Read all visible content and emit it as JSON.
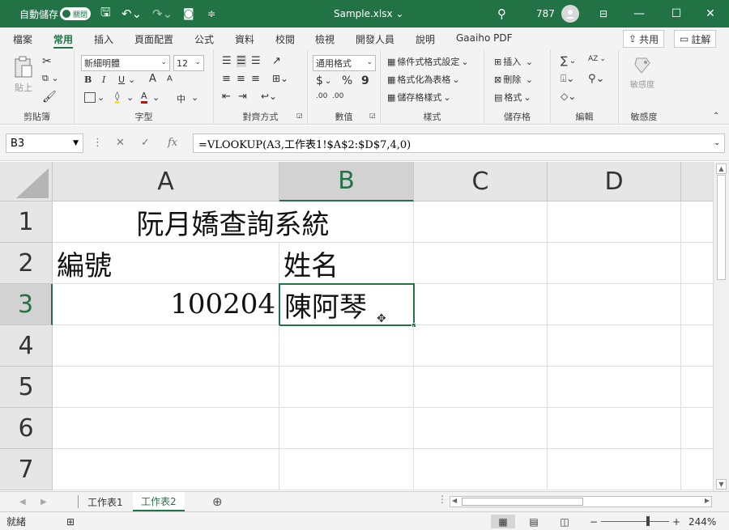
{
  "window": {
    "autosave_label": "自動儲存",
    "autosave_state": "關閉",
    "filename": "Sample.xlsx",
    "user_number": "787",
    "search_icon": "search-icon",
    "accent_color": "#217346"
  },
  "menu": {
    "tabs": [
      "檔案",
      "常用",
      "插入",
      "頁面配置",
      "公式",
      "資料",
      "校閱",
      "檢視",
      "開發人員",
      "說明",
      "Gaaiho PDF"
    ],
    "active_tab": "常用",
    "share_label": "共用",
    "comment_label": "註解"
  },
  "ribbon": {
    "clipboard": {
      "paste_label": "貼上",
      "group_label": "剪貼簿"
    },
    "font": {
      "font_name": "新細明體",
      "font_size": "12",
      "bold": "B",
      "italic": "I",
      "underline": "U",
      "grow": "A",
      "shrink": "A",
      "font_color_letter": "A",
      "phonetic": "中",
      "group_label": "字型"
    },
    "alignment": {
      "group_label": "對齊方式"
    },
    "number": {
      "format": "通用格式",
      "currency": "$",
      "percent": "%",
      "comma": "9",
      "inc_decimals": ".00",
      "dec_decimals": ".00",
      "group_label": "數值"
    },
    "styles": {
      "conditional": "條件式格式設定",
      "table": "格式化為表格",
      "cell_styles": "儲存格樣式",
      "group_label": "樣式"
    },
    "cells": {
      "insert": "插入",
      "delete": "刪除",
      "format": "格式",
      "group_label": "儲存格"
    },
    "editing": {
      "sum": "∑",
      "sort": "AZ",
      "group_label": "編輯"
    },
    "sensitivity": {
      "label": "敏感度",
      "group_label": "敏感度"
    }
  },
  "formula_bar": {
    "name_box": "B3",
    "fx": "fx",
    "formula": "=VLOOKUP(A3,工作表1!$A$2:$D$7,4,0)"
  },
  "grid": {
    "columns": [
      "A",
      "B",
      "C",
      "D"
    ],
    "selected_column": "B",
    "rows": [
      "1",
      "2",
      "3",
      "4",
      "5",
      "6",
      "7"
    ],
    "selected_row": "3",
    "cells": {
      "A1": "阮月嬌查詢系統",
      "A2": "編號",
      "B2": "姓名",
      "A3": "100204",
      "B3": "陳阿琴"
    },
    "active_cell": "B3"
  },
  "sheets": {
    "tabs": [
      "工作表1",
      "工作表2"
    ],
    "active": "工作表2",
    "add_label": "+"
  },
  "status": {
    "ready": "就緒",
    "zoom": "244%",
    "zoom_minus": "−",
    "zoom_plus": "+"
  }
}
